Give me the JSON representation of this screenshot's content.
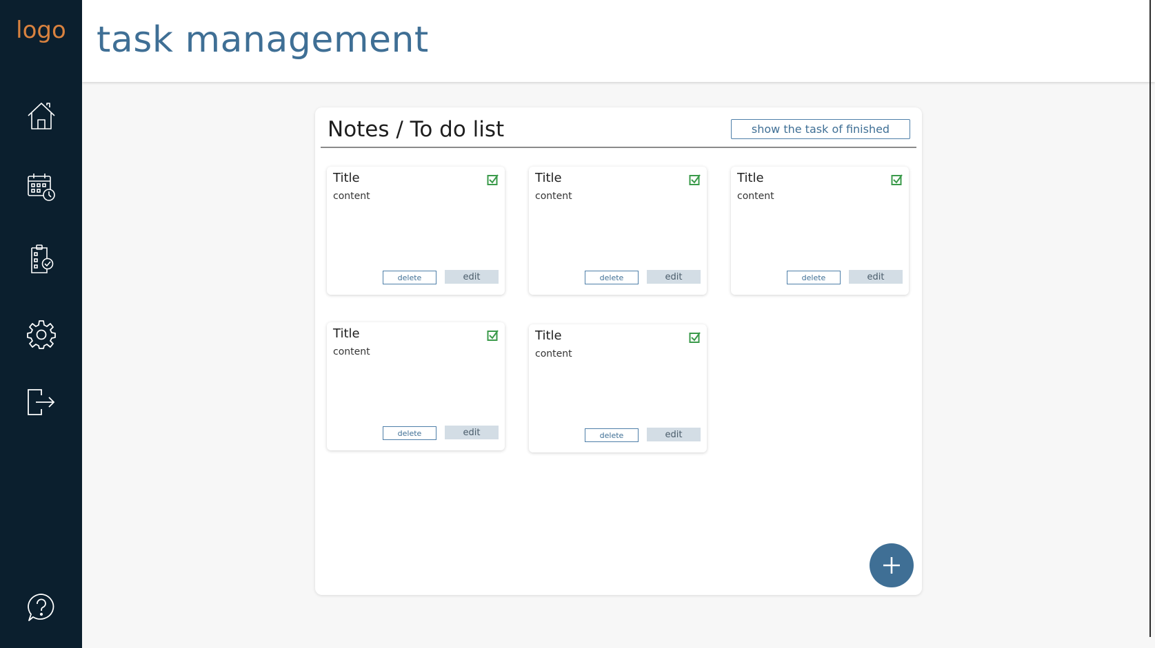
{
  "sidebar": {
    "logo": "logo",
    "items": [
      {
        "icon": "home-icon"
      },
      {
        "icon": "calendar-clock-icon"
      },
      {
        "icon": "clipboard-check-icon"
      },
      {
        "icon": "gear-icon"
      },
      {
        "icon": "logout-icon"
      }
    ],
    "help_icon": "help-icon"
  },
  "header": {
    "title": "task management"
  },
  "panel": {
    "title": "Notes / To do list",
    "show_finished_label": "show the task of finished",
    "add_icon": "plus-icon"
  },
  "notes": [
    {
      "title": "Title",
      "content": "content",
      "done": true,
      "delete_label": "delete",
      "edit_label": "edit"
    },
    {
      "title": "Title",
      "content": "content",
      "done": true,
      "delete_label": "delete",
      "edit_label": "edit"
    },
    {
      "title": "Title",
      "content": "content",
      "done": true,
      "delete_label": "delete",
      "edit_label": "edit"
    },
    {
      "title": "Title",
      "content": "content",
      "done": true,
      "delete_label": "delete",
      "edit_label": "edit"
    },
    {
      "title": "Title",
      "content": "content",
      "done": true,
      "delete_label": "delete",
      "edit_label": "edit"
    }
  ],
  "colors": {
    "sidebar_bg": "#0b1f2e",
    "logo": "#d9823f",
    "accent": "#3f6f95",
    "check": "#3a9a4a",
    "edit_bg": "#d3dde5"
  }
}
